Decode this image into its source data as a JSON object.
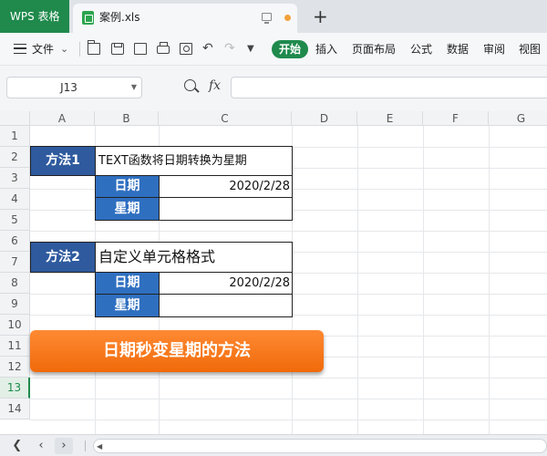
{
  "titlebar": {
    "app_tab": "WPS 表格",
    "file_tab": "案例.xls",
    "new_tab_icon": "plus-icon",
    "brand_color": "#1f8a4c"
  },
  "toolbar": {
    "file_menu": "文件",
    "menus": [
      "开始",
      "插入",
      "页面布局",
      "公式",
      "数据",
      "审阅",
      "视图"
    ],
    "active_menu": "开始"
  },
  "formula_bar": {
    "name_box": "J13",
    "fx_label": "fx",
    "formula": ""
  },
  "grid": {
    "columns": [
      "A",
      "B",
      "C",
      "D",
      "E",
      "F",
      "G"
    ],
    "rows": [
      "1",
      "2",
      "3",
      "4",
      "5",
      "6",
      "7",
      "8",
      "9",
      "10",
      "11",
      "12",
      "13",
      "14"
    ],
    "active_row": "13"
  },
  "cells": {
    "method1": "方法1",
    "method1_desc": "TEXT函数将日期转换为星期",
    "date_label_1": "日期",
    "date_value_1": "2020/2/28",
    "week_label_1": "星期",
    "week_value_1": "",
    "method2": "方法2",
    "method2_desc": "自定义单元格格式",
    "date_label_2": "日期",
    "date_value_2": "2020/2/28",
    "week_label_2": "星期",
    "week_value_2": ""
  },
  "banner": {
    "text": "日期秒变星期的方法",
    "color": "#f47a1f"
  }
}
